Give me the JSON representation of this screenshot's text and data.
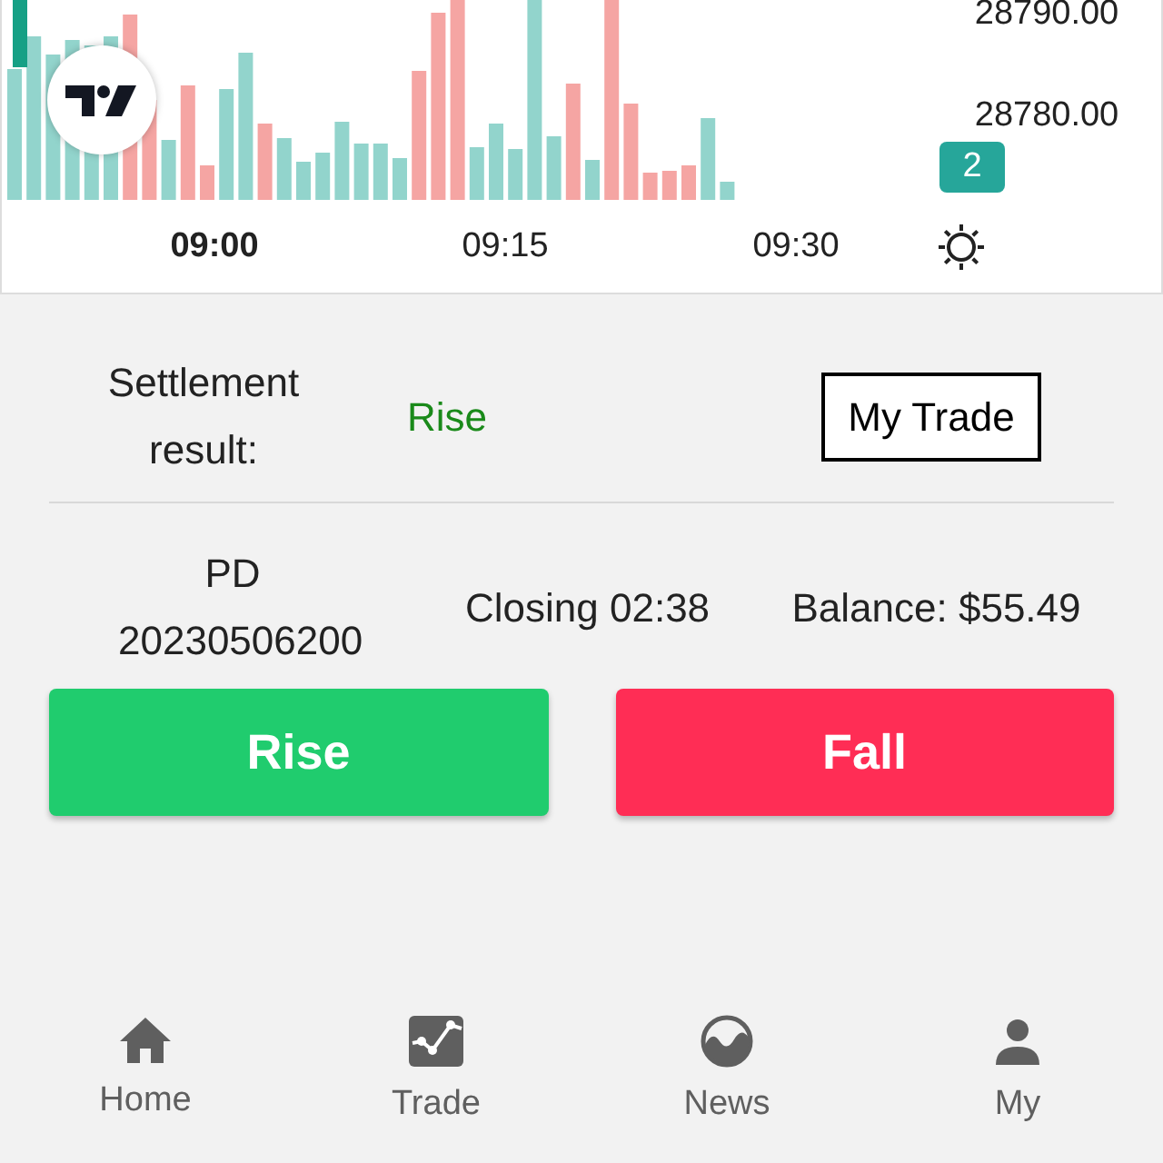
{
  "chart": {
    "price_labels": [
      "28790.00",
      "28780.00"
    ],
    "badge": "2",
    "time_labels": [
      {
        "text": "09:00",
        "emphasized": true
      },
      {
        "text": "09:15",
        "emphasized": false
      },
      {
        "text": "09:30",
        "emphasized": false
      }
    ]
  },
  "settlement": {
    "label": "Settlement result:",
    "value": "Rise",
    "button": "My Trade"
  },
  "info": {
    "product": "PD 20230506200",
    "closing": "Closing 02:38",
    "balance": "Balance: $55.49"
  },
  "actions": [
    {
      "label": "Rise",
      "kind": "rise"
    },
    {
      "label": "Fall",
      "kind": "fall"
    }
  ],
  "nav": [
    {
      "label": "Home",
      "kind": "home"
    },
    {
      "label": "Trade",
      "kind": "trade"
    },
    {
      "label": "News",
      "kind": "news"
    },
    {
      "label": "My",
      "kind": "my"
    }
  ]
}
